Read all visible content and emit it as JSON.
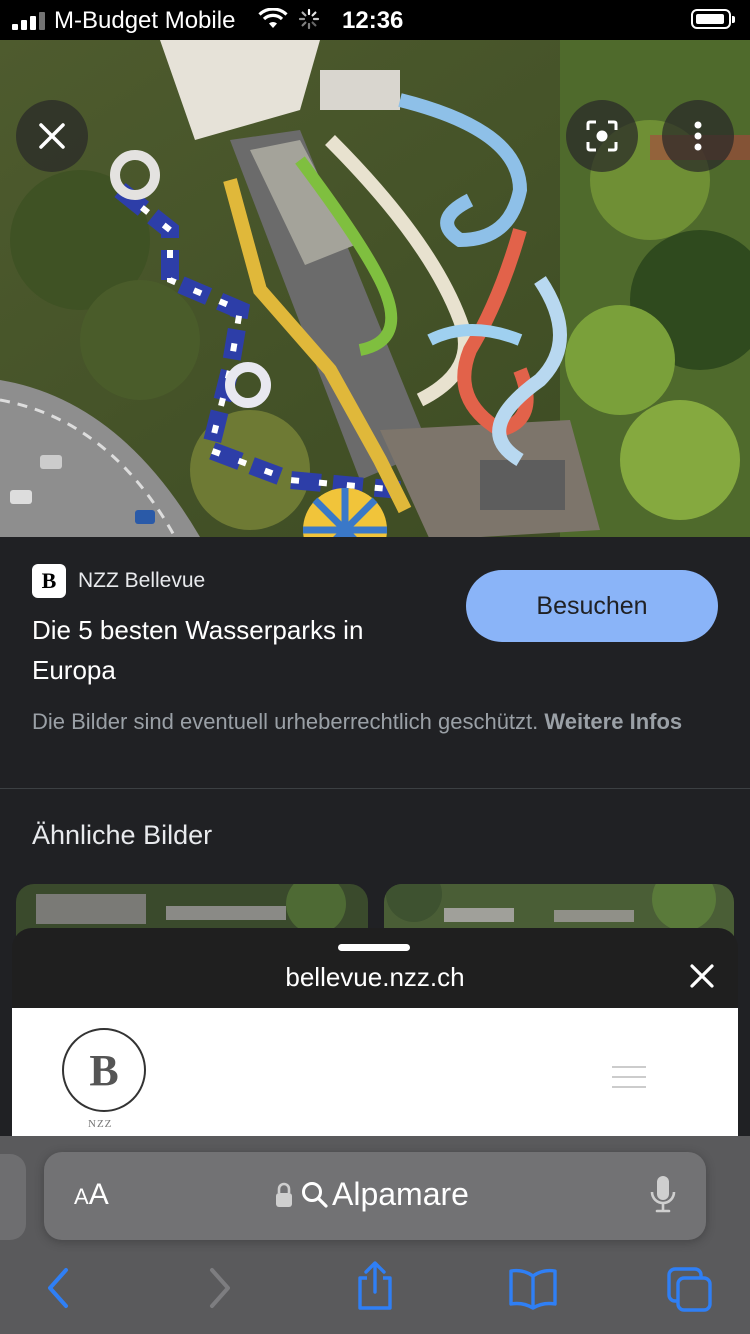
{
  "status_bar": {
    "carrier": "M-Budget Mobile",
    "time": "12:36"
  },
  "image_result": {
    "source_name": "NZZ Bellevue",
    "favicon_letter": "B",
    "title": "Die 5 besten Wasserparks in Europa",
    "visit_label": "Besuchen",
    "copyright_text": "Die Bilder sind eventuell urheberrechtlich geschützt. ",
    "more_info_label": "Weitere Infos",
    "accent_color": "#8ab4f8"
  },
  "similar": {
    "heading": "Ähnliche Bilder"
  },
  "sheet": {
    "domain": "bellevue.nzz.ch",
    "logo_letter": "B",
    "logo_sub": "NZZ"
  },
  "safari": {
    "aa_label_small": "A",
    "aa_label_big": "A",
    "search_text": "Alpamare"
  },
  "icons": [
    "close-icon",
    "lens-icon",
    "more-vert-icon",
    "lock-icon",
    "search-icon",
    "mic-icon",
    "back-icon",
    "forward-icon",
    "share-icon",
    "bookmarks-icon",
    "tabs-icon"
  ]
}
